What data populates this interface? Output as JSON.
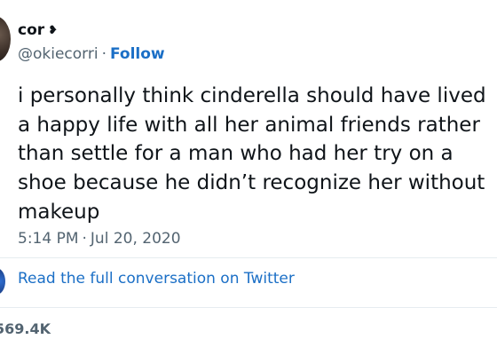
{
  "author": {
    "display_name": "cor",
    "name_emoji": "❥",
    "handle": "@okiecorri",
    "separator": "·",
    "follow_label": "Follow"
  },
  "tweet": {
    "lines": [
      "i personally think cinderella should have lived",
      "a happy life with all her animal friends rather",
      "than settle for a man who had her try on a",
      "shoe because he didn’t recognize her without",
      "makeup"
    ],
    "time": "5:14 PM",
    "separator": "·",
    "date": "Jul 20, 2020"
  },
  "conversation": {
    "link_label": "Read the full conversation on Twitter"
  },
  "stats": {
    "likes": "569.4K"
  }
}
